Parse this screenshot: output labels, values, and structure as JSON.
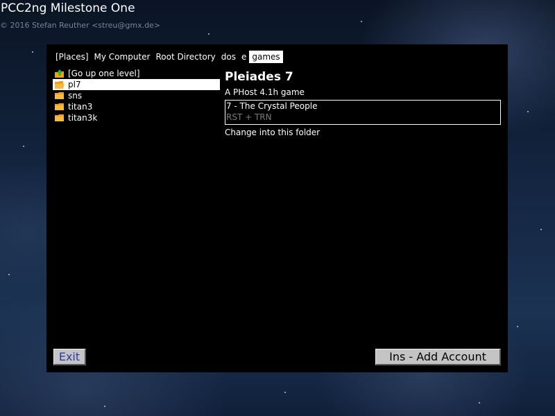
{
  "app": {
    "title": "PCC2ng Milestone One",
    "copyright": "© 2016 Stefan Reuther <streu@gmx.de>"
  },
  "breadcrumb": {
    "places": "[Places]",
    "my_computer": "My Computer",
    "root": "Root Directory",
    "dos": "dos",
    "e": "e",
    "games": "games"
  },
  "file_list": {
    "items": [
      {
        "label": "[Go up one level]",
        "icon": "folder-up-icon"
      },
      {
        "label": "pl7",
        "icon": "folder-icon",
        "selected": true
      },
      {
        "label": "sns",
        "icon": "folder-icon"
      },
      {
        "label": "titan3",
        "icon": "folder-icon"
      },
      {
        "label": "titan3k",
        "icon": "folder-icon"
      }
    ]
  },
  "detail": {
    "title": "Pleiades 7",
    "subtitle": "A PHost 4.1h game",
    "account_name": "7 - The Crystal People",
    "account_files": "RST + TRN",
    "hint": "Change into this folder"
  },
  "buttons": {
    "exit": "Exit",
    "add_account": "Ins - Add Account"
  },
  "colors": {
    "dialog_bg": "#000000",
    "selection_bg": "#ffffff",
    "button_bg": "#c4c4c4",
    "exit_text": "#2a3aa8",
    "folder_icon": "#f0a020",
    "up_arrow": "#30b030"
  }
}
